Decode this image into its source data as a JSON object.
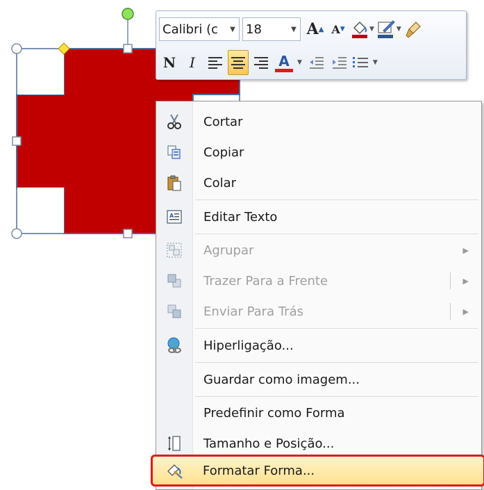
{
  "colors": {
    "shape_fill": "#c00000",
    "accent_highlight": "#ffd36b",
    "highlight_border": "#e31818"
  },
  "mini_toolbar": {
    "font_name": "Calibri (c",
    "font_size": "18",
    "buttons": {
      "grow_font": "A",
      "shrink_font": "A",
      "bold": "N",
      "italic": "I",
      "font_color": "A"
    }
  },
  "context_menu": {
    "items": [
      {
        "label": "Cortar",
        "icon": "scissors-icon"
      },
      {
        "label": "Copiar",
        "icon": "copy-icon"
      },
      {
        "label": "Colar",
        "icon": "paste-icon"
      },
      {
        "label": "Editar Texto",
        "icon": "edit-text-icon"
      },
      {
        "label": "Agrupar",
        "icon": "group-icon",
        "disabled": true
      },
      {
        "label": "Trazer Para a Frente",
        "icon": "bring-forward-icon",
        "disabled": true
      },
      {
        "label": "Enviar Para Trás",
        "icon": "send-backward-icon",
        "disabled": true
      },
      {
        "label": "Hiperligação...",
        "icon": "hyperlink-icon"
      },
      {
        "label": "Guardar como imagem..."
      },
      {
        "label": "Predefinir como Forma"
      },
      {
        "label": "Tamanho e Posição...",
        "icon": "size-position-icon"
      },
      {
        "label": "Formatar Forma...",
        "icon": "format-shape-icon",
        "highlighted": true
      }
    ]
  }
}
